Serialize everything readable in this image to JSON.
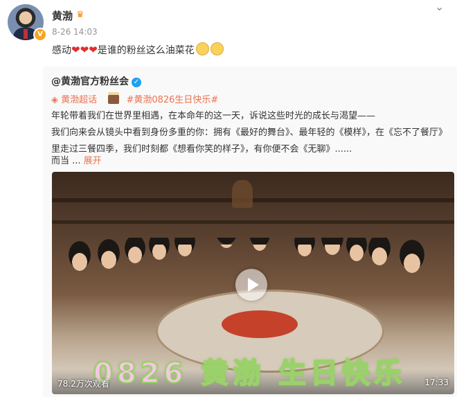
{
  "post": {
    "author": "黄渤",
    "timestamp": "8-26 14:03",
    "text_before_hearts": "感动",
    "hearts": [
      "❤",
      "❤",
      "❤"
    ],
    "text_after_hearts": "是谁的粉丝这么油菜花",
    "more_icon": "chevron-down-icon",
    "verified_badge": "V"
  },
  "repost": {
    "author": "@黄渤官方粉丝会",
    "topic_supertalk": "黄渤超话",
    "topic_hashtag": "#黄渤0826生日快乐#",
    "lines": [
      "年轮带着我们在世界里相遇，在本命年的这一天，诉说这些时光的成长与渴望——",
      "我们向来会从镜头中看到身份多重的你：拥有《最好的舞台》、最年轻的《模样》，在《忘不了餐厅》",
      "里走过三餐四季，我们时刻都《想看你笑的样子》，有你便不会《无聊》......",
      "而当  ... "
    ],
    "expand_label": "展开"
  },
  "video": {
    "overlay_text": "0826 黄渤 生日快乐",
    "views": "78.2万次观看",
    "duration": "17:33"
  },
  "colors": {
    "accent": "#eb7350",
    "heart": "#e32e2e",
    "verified_blue": "#1da1f2",
    "verified_orange": "#f5a623"
  }
}
